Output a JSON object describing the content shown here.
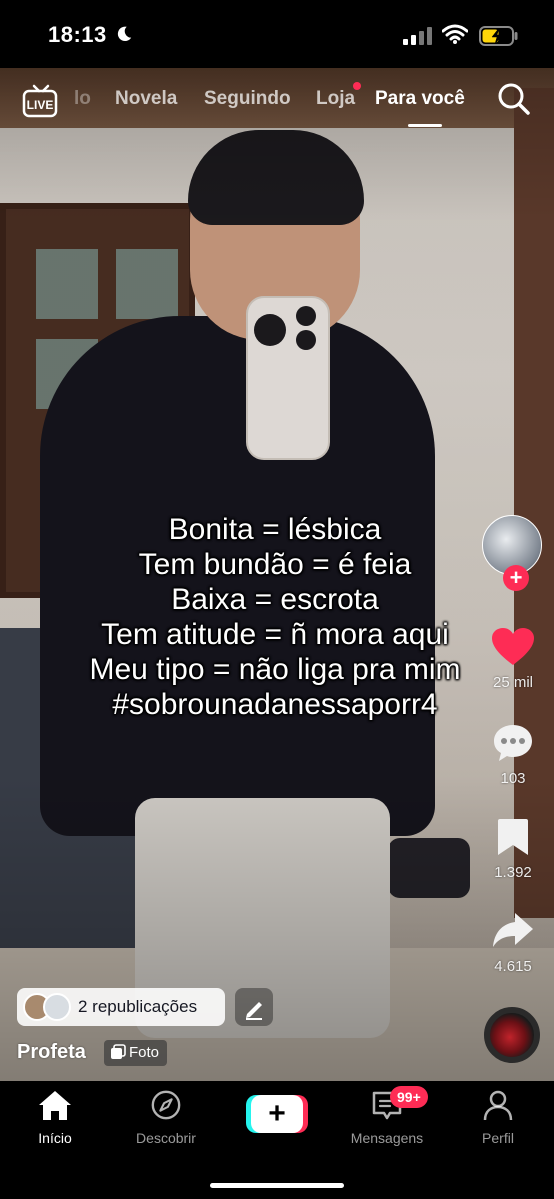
{
  "status_bar": {
    "time": "18:13"
  },
  "top_nav": {
    "tabs": [
      {
        "label": "lo"
      },
      {
        "label": "Novela"
      },
      {
        "label": "Seguindo"
      },
      {
        "label": "Loja"
      },
      {
        "label": "Para você"
      }
    ],
    "active_tab": "Para você",
    "live_label": "LIVE"
  },
  "post": {
    "overlay_lines": [
      "Bonita = lésbica",
      "Tem bundão = é feia",
      "Baixa = escrota",
      "Tem atitude = ñ mora aqui",
      "Meu tipo = não liga pra mim",
      "#sobrounadanessaporr4"
    ],
    "username": "Profeta",
    "badge": "Foto",
    "reposts": "2 republicações"
  },
  "actions": {
    "likes": "25 mil",
    "comments": "103",
    "saves": "1.392",
    "shares": "4.615"
  },
  "tab_bar": {
    "home": "Início",
    "discover": "Descobrir",
    "messages": "Mensagens",
    "messages_badge": "99+",
    "profile": "Perfil"
  },
  "colors": {
    "accent": "#fe2c55",
    "cyan": "#25f4ee"
  },
  "icons": [
    "moon-icon",
    "signal-icon",
    "wifi-icon",
    "battery-icon",
    "live-icon",
    "search-icon",
    "heart-icon",
    "comment-icon",
    "bookmark-icon",
    "share-icon",
    "edit-icon",
    "photo-icon",
    "home-icon",
    "compass-icon",
    "message-icon",
    "profile-icon"
  ]
}
